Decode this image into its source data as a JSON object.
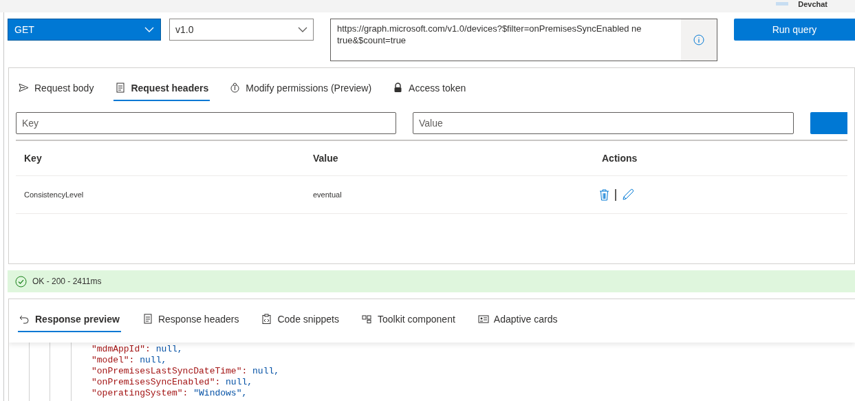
{
  "header": {
    "user": "Devchat"
  },
  "query": {
    "method": "GET",
    "version": "v1.0",
    "url": "https://graph.microsoft.com/v1.0/devices?$filter=onPremisesSyncEnabled ne true&$count=true",
    "run_label": "Run query"
  },
  "request_tabs": [
    {
      "label": "Request body",
      "selected": false
    },
    {
      "label": "Request headers",
      "selected": true
    },
    {
      "label": "Modify permissions (Preview)",
      "selected": false
    },
    {
      "label": "Access token",
      "selected": false
    }
  ],
  "header_form": {
    "key_placeholder": "Key",
    "value_placeholder": "Value"
  },
  "headers_table": {
    "columns": [
      "Key",
      "Value",
      "Actions"
    ],
    "rows": [
      {
        "key": "ConsistencyLevel",
        "value": "eventual"
      }
    ]
  },
  "status": {
    "text": "OK - 200 - 2411ms"
  },
  "response_tabs": [
    {
      "label": "Response preview",
      "selected": true
    },
    {
      "label": "Response headers",
      "selected": false
    },
    {
      "label": "Code snippets",
      "selected": false
    },
    {
      "label": "Toolkit component",
      "selected": false
    },
    {
      "label": "Adaptive cards",
      "selected": false
    }
  ],
  "response_lines": [
    {
      "key": "\"mdmAppId\":",
      "value": "null,"
    },
    {
      "key": "\"model\":",
      "value": "null,"
    },
    {
      "key": "\"onPremisesLastSyncDateTime\":",
      "value": "null,"
    },
    {
      "key": "\"onPremisesSyncEnabled\":",
      "value": "null,"
    },
    {
      "key": "\"operatingSystem\":",
      "value": "\"Windows\","
    }
  ]
}
